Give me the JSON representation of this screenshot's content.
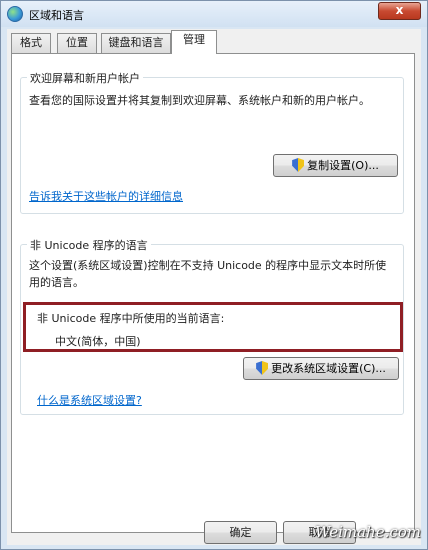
{
  "window": {
    "title": "区域和语言",
    "close_label": "x"
  },
  "tabs": [
    {
      "label": "格式",
      "active": false
    },
    {
      "label": "位置",
      "active": false
    },
    {
      "label": "键盘和语言",
      "active": false
    },
    {
      "label": "管理",
      "active": true
    }
  ],
  "welcome_group": {
    "title": "欢迎屏幕和新用户帐户",
    "description": "查看您的国际设置并将其复制到欢迎屏幕、系统帐户和新的用户帐户。",
    "copy_button": "复制设置(O)...",
    "link": "告诉我关于这些帐户的详细信息"
  },
  "unicode_group": {
    "title": "非 Unicode 程序的语言",
    "description_line1": "这个设置(系统区域设置)控制在不支持 Unicode 的程序中显示文本时所使",
    "description_line2": "用的语言。",
    "current_label": "非 Unicode 程序中所使用的当前语言:",
    "current_value": "中文(简体，中国)",
    "change_button": "更改系统区域设置(C)...",
    "link": "什么是系统区域设置?"
  },
  "footer": {
    "ok_label": "确定",
    "cancel_label": "取消"
  },
  "watermark": "Weimahe.com",
  "colors": {
    "highlight_border": "#8f1e24",
    "link": "#0066cc"
  }
}
